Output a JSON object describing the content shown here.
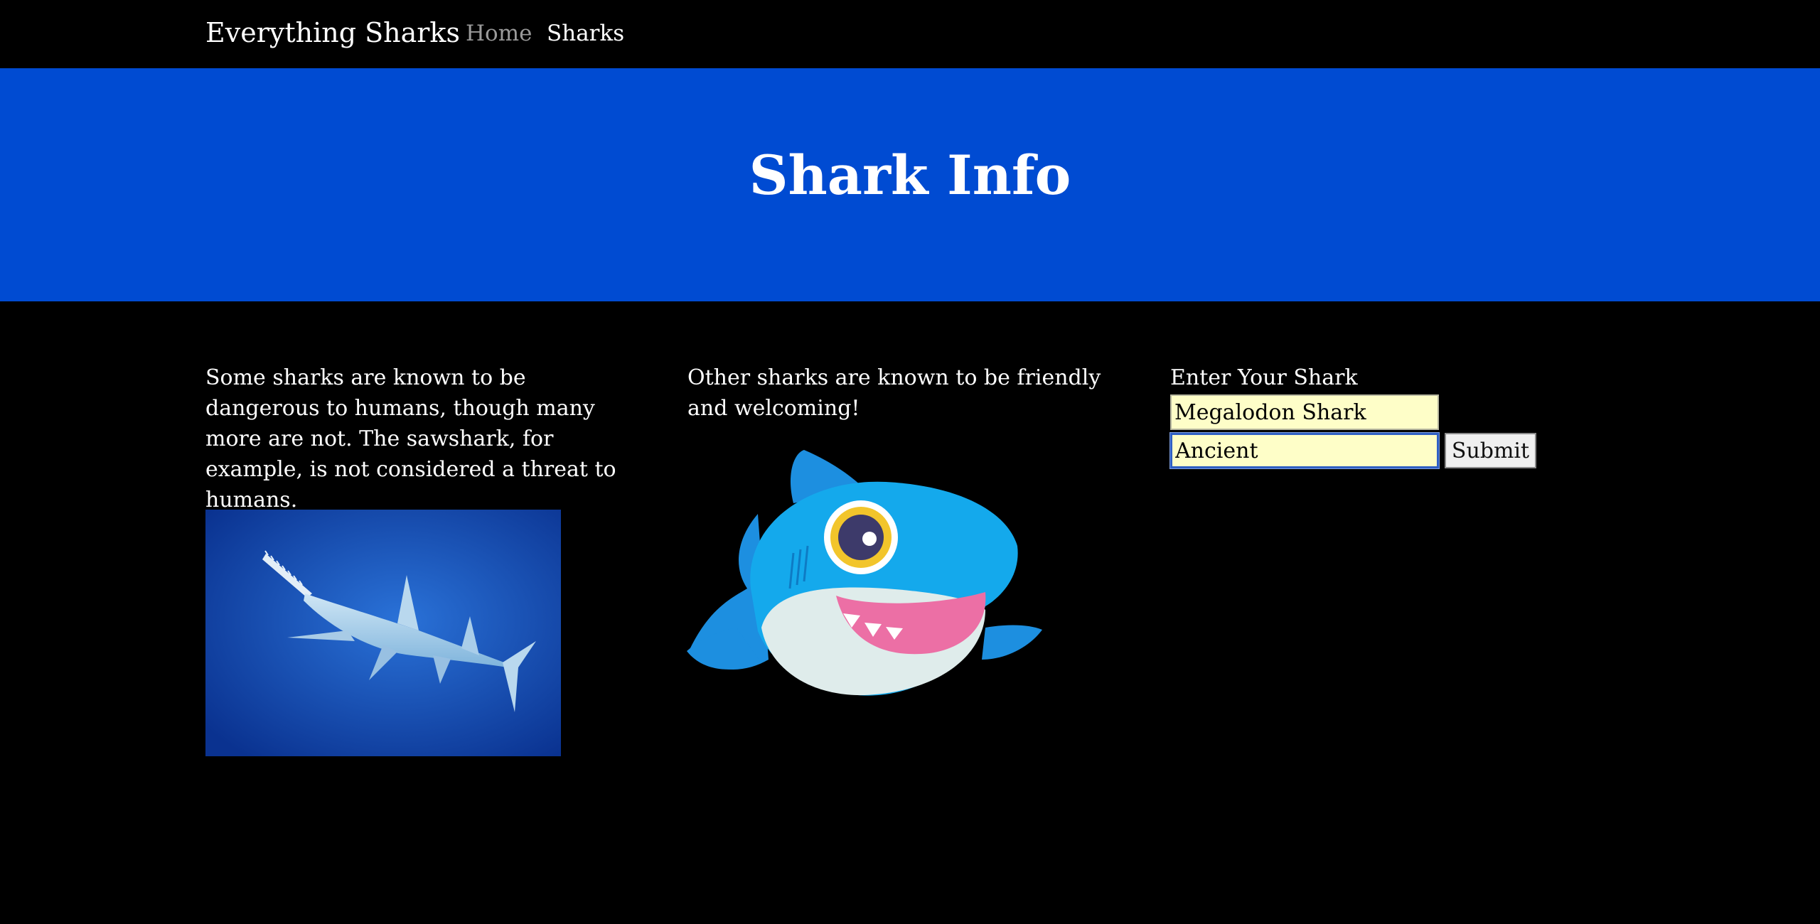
{
  "navbar": {
    "brand": "Everything Sharks",
    "links": [
      {
        "label": "Home",
        "active": false
      },
      {
        "label": "Sharks",
        "active": true
      }
    ]
  },
  "hero": {
    "title": "Shark Info",
    "background_color": "#004bd2"
  },
  "columns": {
    "dangerous": {
      "text": "Some sharks are known to be dangerous to humans, though many more are not. The sawshark, for example, is not considered a threat to humans.",
      "image": "sawshark-photo"
    },
    "friendly": {
      "text": "Other sharks are known to be friendly and welcoming!",
      "image": "cartoon-shark-illustration"
    }
  },
  "form": {
    "label": "Enter Your Shark",
    "name_value": "Megalodon Shark",
    "character_value": "Ancient",
    "submit_label": "Submit",
    "input_background": "#fefec8"
  }
}
